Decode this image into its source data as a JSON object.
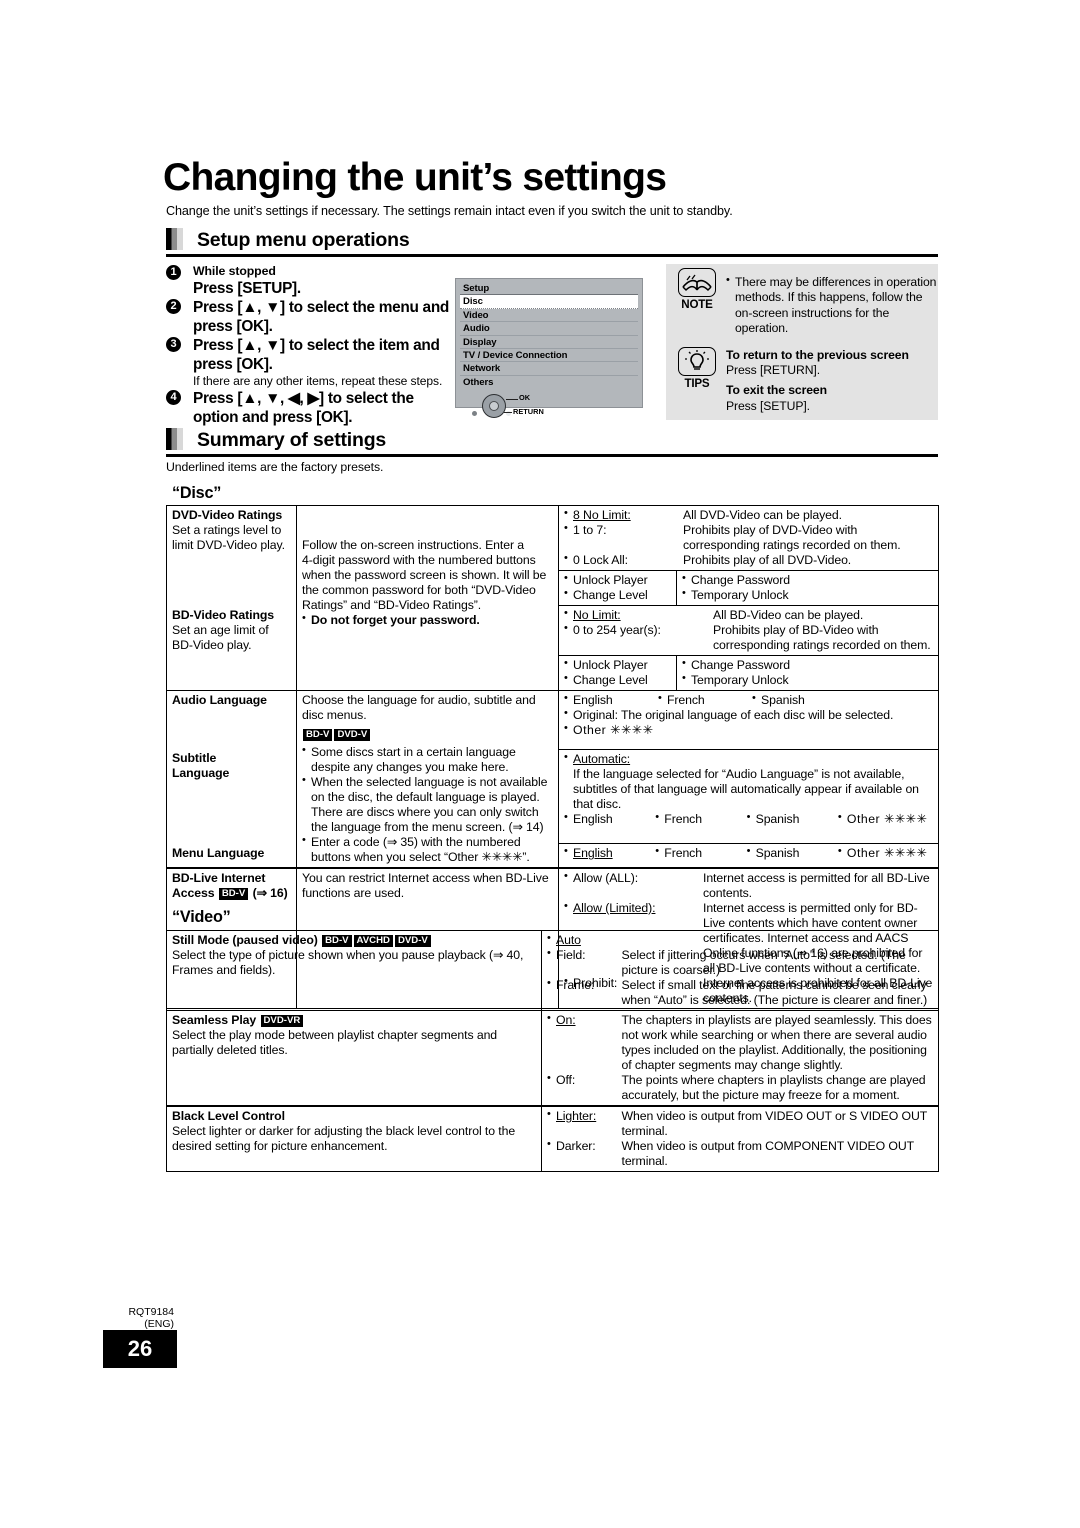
{
  "document": {
    "title": "Changing the unit’s settings",
    "intro": "Change the unit’s settings if necessary. The settings remain intact even if you switch the unit to standby.",
    "footer_code_line1": "RQT9184",
    "footer_code_line2": "(ENG)",
    "page_number": "26"
  },
  "section_setup": {
    "heading": "Setup menu operations",
    "steps": [
      {
        "num": "1",
        "small": "While stopped",
        "big": "Press [SETUP]."
      },
      {
        "num": "2",
        "big": "Press [▲, ▼] to select the menu and press [OK]."
      },
      {
        "num": "3",
        "big": "Press [▲, ▼] to select the item and press [OK].",
        "note": "If there are any other items, repeat these steps."
      },
      {
        "num": "4",
        "big": "Press [▲, ▼, ◀, ▶] to select the option and press [OK]."
      }
    ],
    "setup_screen": {
      "title": "Setup",
      "items": [
        "Disc",
        "Video",
        "Audio",
        "Display",
        "TV / Device Connection",
        "Network",
        "Others"
      ],
      "selected": "Disc",
      "ok_label": "OK",
      "return_label": "RETURN"
    },
    "note": {
      "caption": "NOTE",
      "text": "There may be differences in operation methods. If this happens, follow the on-screen instructions for the operation."
    },
    "tips": {
      "caption": "TIPS",
      "entries": [
        {
          "heading": "To return to the previous screen",
          "body": "Press [RETURN]."
        },
        {
          "heading": "To exit the screen",
          "body": "Press [SETUP]."
        }
      ]
    }
  },
  "section_summary": {
    "heading": "Summary of settings",
    "note": "Underlined items are the factory presets.",
    "disc_group_title": "“Disc”",
    "video_group_title": "“Video”"
  },
  "disc_table": {
    "dvd_ratings": {
      "name": "DVD-Video Ratings",
      "desc": "Set a ratings level to limit DVD-Video play.",
      "shared_desc_l1": "Follow the on-screen instructions. Enter a",
      "shared_desc_l2": "4-digit password with the numbered buttons",
      "shared_desc_l3": "when the password screen is shown. It will be",
      "shared_desc_l4": "the common password for both “DVD-Video",
      "shared_desc_l5": "Ratings” and “BD-Video Ratings”.",
      "shared_warning": "Do not forget your password.",
      "opt1_key": "8 No Limit:",
      "opt1_val": "All DVD-Video can be played.",
      "opt2_key": "1 to 7:",
      "opt2_val": "Prohibits play of DVD-Video with corresponding ratings recorded on them.",
      "opt3_key": "0 Lock All:",
      "opt3_val": "Prohibits play of all DVD-Video.",
      "sub1": "Unlock Player",
      "sub2": "Change Password",
      "sub3": "Change Level",
      "sub4": "Temporary Unlock"
    },
    "bd_ratings": {
      "name": "BD-Video Ratings",
      "desc": "Set an age limit of BD-Video play.",
      "opt1_key": "No Limit:",
      "opt1_val": "All BD-Video can be played.",
      "opt2_key": "0 to 254 year(s):",
      "opt2_val": "Prohibits play of BD-Video with corresponding ratings recorded on them.",
      "sub1": "Unlock Player",
      "sub2": "Change Password",
      "sub3": "Change Level",
      "sub4": "Temporary Unlock"
    },
    "audio_language": {
      "name": "Audio Language",
      "desc": "Choose the language for audio, subtitle and disc menus.",
      "badge1": "BD-V",
      "badge2": "DVD-V",
      "opt_en": "English",
      "opt_fr": "French",
      "opt_es": "Spanish",
      "opt_original": "Original: The original language of each disc will be selected.",
      "opt_other": "Other ✳✳✳✳"
    },
    "subtitle_language": {
      "name_l1": "Subtitle",
      "name_l2": "Language",
      "bullet1": "Some discs start in a certain language despite any changes you make here.",
      "bullet2": "When the selected language is not available on the disc, the default language is played. There are discs where you can only switch the language from the menu screen. (⇒ 14)",
      "opt_auto": "Automatic:",
      "opt_auto_desc": "If the language selected for “Audio Language” is not available, subtitles of that language will automatically appear if available on that disc.",
      "opt_en": "English",
      "opt_fr": "French",
      "opt_es": "Spanish",
      "opt_other": "Other ✳✳✳✳"
    },
    "menu_language": {
      "name": "Menu Language",
      "bullet1": "Enter a code (⇒ 35) with the numbered buttons when you select “Other ✳✳✳✳”.",
      "opt_en": "English",
      "opt_fr": "French",
      "opt_es": "Spanish",
      "opt_other": "Other ✳✳✳✳"
    },
    "bd_live": {
      "name_l1": "BD-Live Internet",
      "name_l2": "Access",
      "badge": "BD-V",
      "name_ref": "(⇒ 16)",
      "desc": "You can restrict Internet access when BD-Live functions are used.",
      "opt1_key": "Allow (ALL):",
      "opt1_val": "Internet access is permitted for all BD-Live contents.",
      "opt2_key": "Allow (Limited):",
      "opt2_val": "Internet access is permitted only for BD-Live contents which have content owner certificates. Internet access and AACS Online functions (⇒ 16) are prohibited for all BD-Live contents without a certificate.",
      "opt3_key": "Prohibit:",
      "opt3_val": "Internet access is prohibited for all BD-Live contents."
    }
  },
  "video_table": {
    "still_mode": {
      "name": "Still Mode (paused video)",
      "badge1": "BD-V",
      "badge2": "AVCHD",
      "badge3": "DVD-V",
      "desc": "Select the type of picture shown when you pause playback (⇒ 40, Frames and fields).",
      "opt1_key": "Auto",
      "opt2_key": "Field:",
      "opt2_val": "Select if jittering occurs when “Auto” is selected. (The picture is coarser.)",
      "opt3_key": "Frame:",
      "opt3_val": "Select if small text or fine patterns cannot be seen clearly when “Auto” is selected. (The picture is clearer and finer.)"
    },
    "seamless_play": {
      "name": "Seamless Play",
      "badge1": "DVD-VR",
      "desc": "Select the play mode between playlist chapter segments and partially deleted titles.",
      "opt1_key": "On:",
      "opt1_val": "The chapters in playlists are played seamlessly. This does not work while searching or when there are several audio types included on the playlist. Additionally, the positioning of chapter segments may change slightly.",
      "opt2_key": "Off:",
      "opt2_val": "The points where chapters in playlists change are played accurately, but the picture may freeze for a moment."
    },
    "black_level": {
      "name": "Black Level Control",
      "desc": "Select lighter or darker for adjusting the black level control to the desired setting for picture enhancement.",
      "opt1_key": "Lighter:",
      "opt1_val": "When video is output from VIDEO OUT or S VIDEO OUT terminal.",
      "opt2_key": "Darker:",
      "opt2_val": "When video is output from COMPONENT VIDEO OUT terminal."
    }
  }
}
